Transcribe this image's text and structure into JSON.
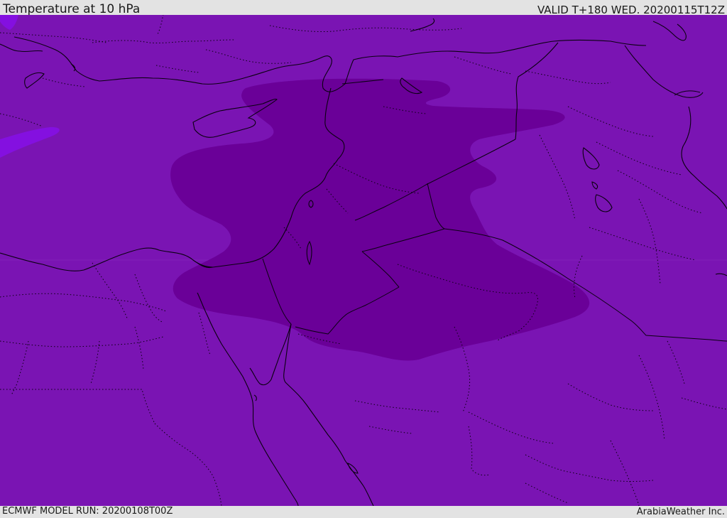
{
  "header": {
    "title": "Temperature at 10 hPa",
    "valid": "VALID T+180 WED. 20200115T12Z"
  },
  "footer": {
    "model_run": "ECMWF MODEL RUN: 20200108T00Z",
    "credit": "ArabiaWeather Inc."
  },
  "map": {
    "colors": {
      "base_field": "#7a14b3",
      "cold_core": "#6a0098",
      "warm_patch": "#8410e0",
      "coastline": "#0a0010",
      "border_dotted": "#0a0010",
      "top_bar": "#e3e3e3"
    },
    "layers": [
      "temperature-field",
      "cold-core-contour",
      "coastlines",
      "country-borders",
      "internal-borders"
    ]
  }
}
